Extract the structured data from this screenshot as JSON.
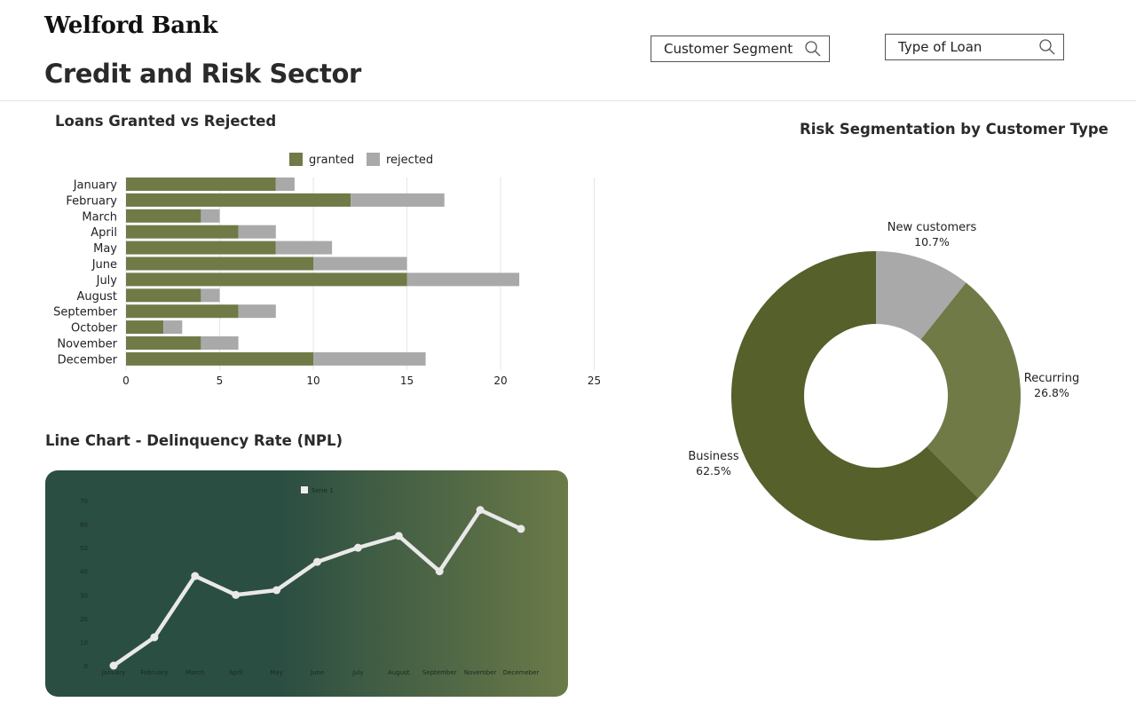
{
  "header": {
    "brand": "Welford Bank",
    "title": "Credit and Risk Sector"
  },
  "filters": {
    "customer_segment": "Customer Segment",
    "loan_type": "Type of Loan",
    "search_icon": "search-icon"
  },
  "colors": {
    "granted": "#6f7a47",
    "rejected": "#a9a9a9",
    "donut_dark": "#55602a",
    "donut_mid": "#6f7a47",
    "donut_light": "#a9a9a9",
    "line_panel_start": "#2b4e42",
    "line_panel_end": "#6b7a48",
    "line": "#e9e9e9"
  },
  "chart_data": [
    {
      "type": "bar",
      "orientation": "horizontal",
      "stacked": true,
      "title": "Loans Granted vs Rejected",
      "categories": [
        "January",
        "February",
        "March",
        "April",
        "May",
        "June",
        "July",
        "August",
        "September",
        "October",
        "November",
        "December"
      ],
      "series": [
        {
          "name": "granted",
          "values": [
            8,
            12,
            4,
            6,
            8,
            10,
            15,
            4,
            6,
            2,
            4,
            10
          ]
        },
        {
          "name": "rejected",
          "values": [
            1,
            5,
            1,
            2,
            3,
            5,
            6,
            1,
            2,
            1,
            2,
            6
          ]
        }
      ],
      "xlim": [
        0,
        25
      ],
      "xticks": [
        0,
        5,
        10,
        15,
        20,
        25
      ],
      "grid": true,
      "legend": "top"
    },
    {
      "type": "pie",
      "donut": true,
      "title": "Risk Segmentation by Customer Type",
      "slices": [
        {
          "label": "New customers",
          "value": 10.7,
          "pct_label": "10.7%"
        },
        {
          "label": "Recurring",
          "value": 26.8,
          "pct_label": "26.8%"
        },
        {
          "label": "Business",
          "value": 62.5,
          "pct_label": "62.5%"
        }
      ]
    },
    {
      "type": "line",
      "title": "Line Chart - Delinquency Rate (NPL)",
      "categories": [
        "January",
        "February",
        "March",
        "April",
        "May",
        "June",
        "July",
        "August",
        "September",
        "November",
        "Decemeber"
      ],
      "series": [
        {
          "name": "Serie 1",
          "values": [
            0,
            12,
            38,
            30,
            32,
            44,
            50,
            55,
            40,
            66,
            58
          ]
        }
      ],
      "ylim": [
        0,
        70
      ],
      "yticks": [
        0,
        10,
        20,
        30,
        40,
        50,
        60,
        70
      ],
      "grid": false,
      "legend": "top"
    }
  ]
}
